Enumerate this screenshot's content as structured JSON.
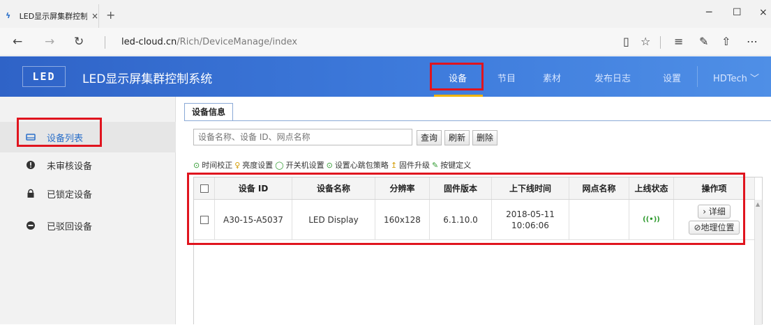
{
  "browser": {
    "tab_title": "LED显示屏集群控制系统",
    "tab_close": "×",
    "new_tab": "+",
    "url_host": "led-cloud.cn",
    "url_path": "/Rich/DeviceManage/index",
    "win_min": "─",
    "win_max": "☐",
    "win_close": "×"
  },
  "app": {
    "logo_text": "LED",
    "title": "LED显示屏集群控制系统",
    "nav": [
      {
        "label": "设备",
        "active": true
      },
      {
        "label": "节目"
      },
      {
        "label": "素材"
      },
      {
        "label": "发布日志"
      },
      {
        "label": "设置"
      },
      {
        "label": "HDTech"
      }
    ],
    "accent": "#f0b400",
    "header_color": "#3e7bdc"
  },
  "sidebar": {
    "items": [
      {
        "label": "设备列表",
        "icon": "monitor-icon",
        "active": true
      },
      {
        "label": "未审核设备",
        "icon": "alert-circle-icon"
      },
      {
        "label": "已锁定设备",
        "icon": "lock-icon"
      },
      {
        "label": "已驳回设备",
        "icon": "minus-circle-icon"
      }
    ]
  },
  "main": {
    "tab_label": "设备信息",
    "search_placeholder": "设备名称、设备 ID、网点名称",
    "buttons": {
      "query": "查询",
      "refresh": "刷新",
      "delete": "删除"
    },
    "toolbar": [
      {
        "icon": "⊙",
        "label": "时间校正"
      },
      {
        "icon": "♀",
        "label": "亮度设置"
      },
      {
        "icon": "◯",
        "label": "开关机设置"
      },
      {
        "icon": "⊙",
        "label": "设置心跳包策略"
      },
      {
        "icon": "↥",
        "label": "固件升级"
      },
      {
        "icon": "✎",
        "label": "按键定义"
      }
    ],
    "table": {
      "columns": [
        "设备 ID",
        "设备名称",
        "分辨率",
        "固件版本",
        "上下线时间",
        "网点名称",
        "上线状态",
        "操作项"
      ],
      "rows": [
        {
          "id": "A30-15-A5037",
          "name": "LED Display",
          "resolution": "160x128",
          "firmware": "6.1.10.0",
          "time_date": "2018-05-11",
          "time_clock": "10:06:06",
          "site": "",
          "status_icon": "((•))",
          "op_detail": "› 详细",
          "op_geo": "⊘地理位置"
        }
      ]
    }
  }
}
